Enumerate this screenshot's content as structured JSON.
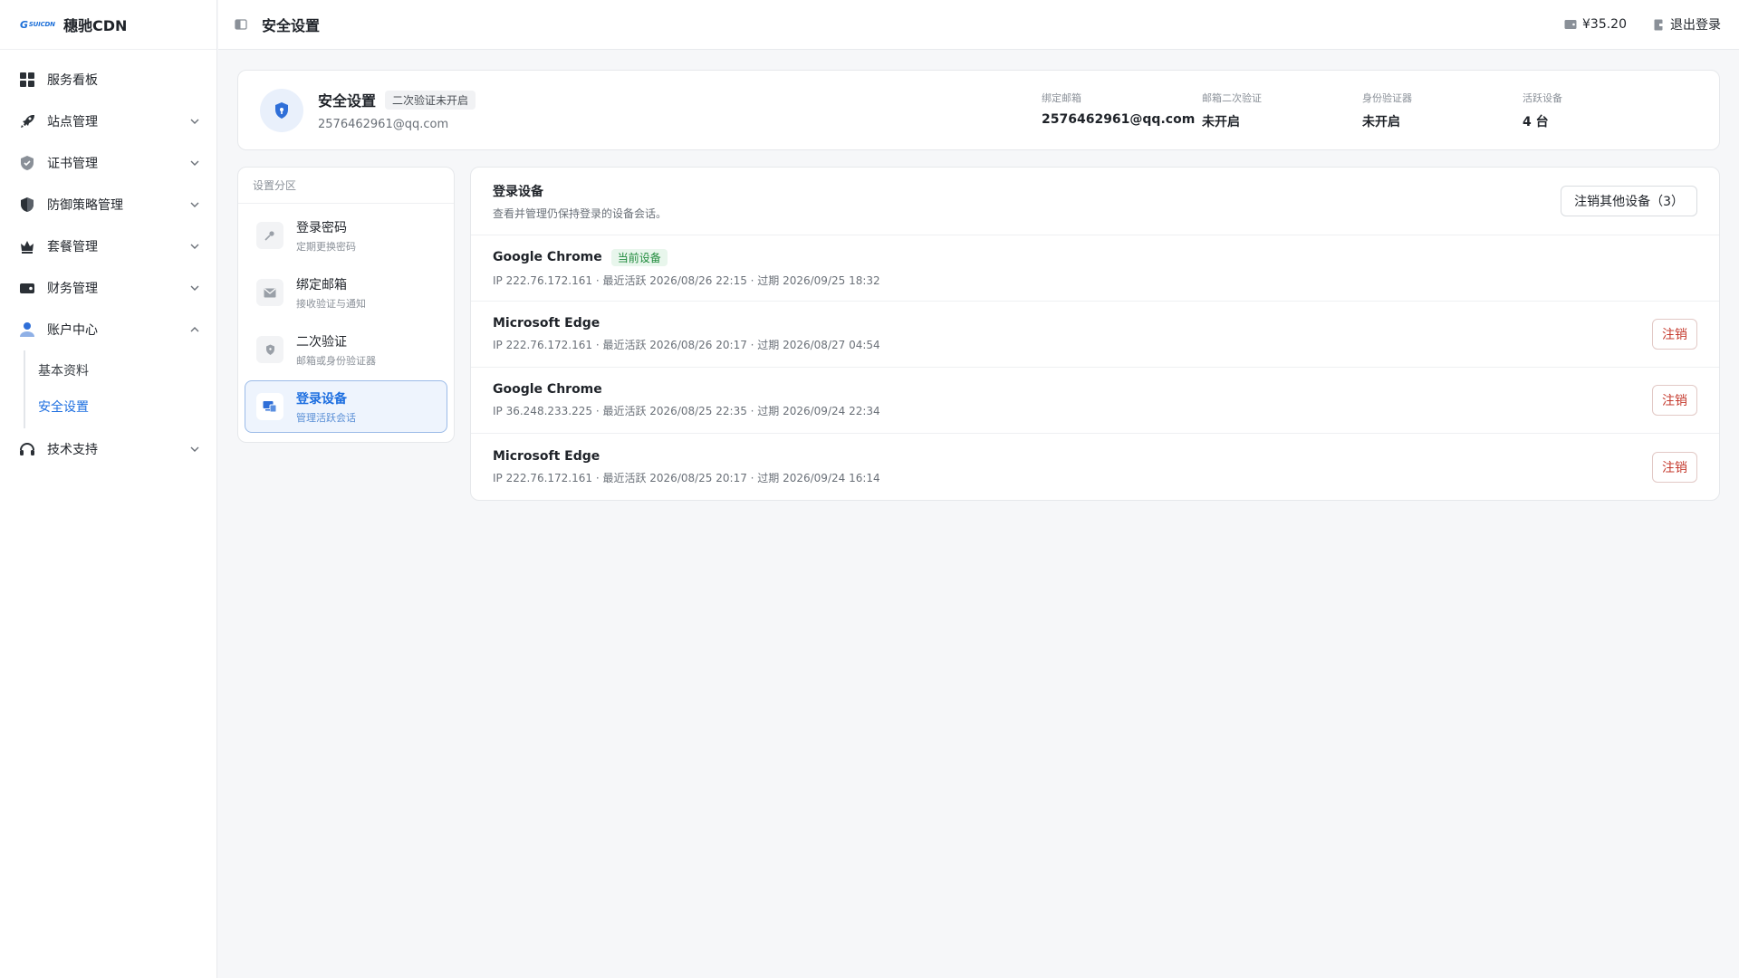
{
  "brand": {
    "logo_text": "穗驰CDN",
    "name": "穗驰CDN"
  },
  "nav": [
    {
      "label": "服务看板",
      "icon": "dashboard-icon",
      "expandable": false
    },
    {
      "label": "站点管理",
      "icon": "rocket-icon",
      "expandable": true
    },
    {
      "label": "证书管理",
      "icon": "certificate-shield-icon",
      "expandable": true
    },
    {
      "label": "防御策略管理",
      "icon": "defense-shield-icon",
      "expandable": true
    },
    {
      "label": "套餐管理",
      "icon": "crown-icon",
      "expandable": true
    },
    {
      "label": "财务管理",
      "icon": "wallet-icon",
      "expandable": true
    },
    {
      "label": "账户中心",
      "icon": "user-icon",
      "expandable": true,
      "expanded": true
    },
    {
      "label": "技术支持",
      "icon": "headset-icon",
      "expandable": true
    }
  ],
  "account_sub": [
    {
      "label": "基本资料",
      "active": false
    },
    {
      "label": "安全设置",
      "active": true
    }
  ],
  "topbar": {
    "title": "安全设置",
    "balance": "¥35.20",
    "logout": "退出登录"
  },
  "summary": {
    "title": "安全设置",
    "badge": "二次验证未开启",
    "email": "2576462961@qq.com",
    "stats": [
      {
        "label": "绑定邮箱",
        "value": "2576462961@qq.com"
      },
      {
        "label": "邮箱二次验证",
        "value": "未开启"
      },
      {
        "label": "身份验证器",
        "value": "未开启"
      },
      {
        "label": "活跃设备",
        "value": "4 台"
      }
    ]
  },
  "sections": {
    "head": "设置分区",
    "items": [
      {
        "title": "登录密码",
        "desc": "定期更换密码",
        "icon": "key-icon",
        "active": false
      },
      {
        "title": "绑定邮箱",
        "desc": "接收验证与通知",
        "icon": "mail-icon",
        "active": false
      },
      {
        "title": "二次验证",
        "desc": "邮箱或身份验证器",
        "icon": "shield-icon",
        "active": false
      },
      {
        "title": "登录设备",
        "desc": "管理活跃会话",
        "icon": "devices-icon",
        "active": true
      }
    ]
  },
  "devices": {
    "title": "登录设备",
    "desc": "查看并管理仍保持登录的设备会话。",
    "revoke_others": "注销其他设备（3）",
    "current_badge": "当前设备",
    "revoke_label": "注销",
    "rows": [
      {
        "name": "Google Chrome",
        "current": true,
        "meta": "IP 222.76.172.161 · 最近活跃 2026/08/26 22:15 · 过期 2026/09/25 18:32"
      },
      {
        "name": "Microsoft Edge",
        "current": false,
        "meta": "IP 222.76.172.161 · 最近活跃 2026/08/26 20:17 · 过期 2026/08/27 04:54"
      },
      {
        "name": "Google Chrome",
        "current": false,
        "meta": "IP 36.248.233.225 · 最近活跃 2026/08/25 22:35 · 过期 2026/09/24 22:34"
      },
      {
        "name": "Microsoft Edge",
        "current": false,
        "meta": "IP 222.76.172.161 · 最近活跃 2026/08/25 20:17 · 过期 2026/09/24 16:14"
      }
    ]
  }
}
